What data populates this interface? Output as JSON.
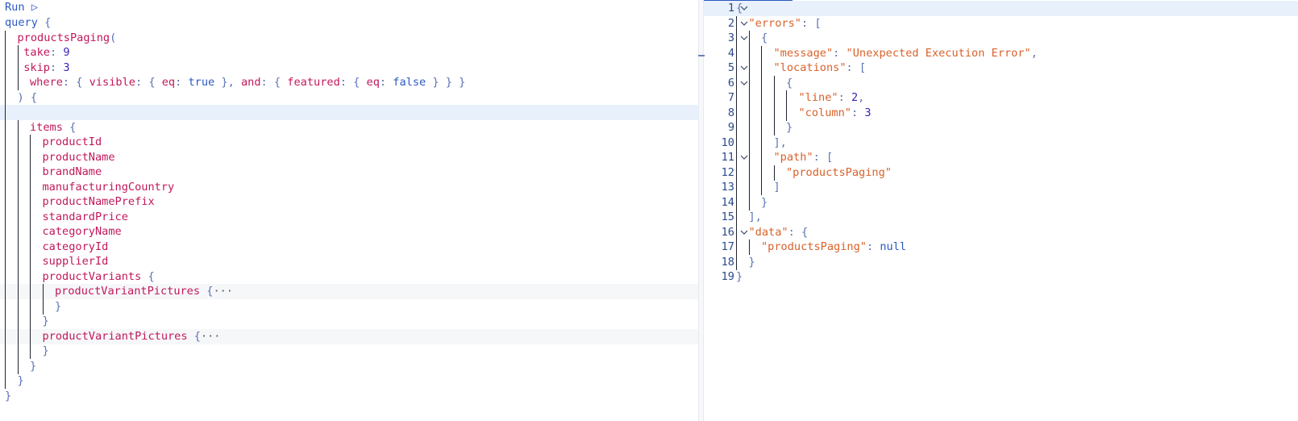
{
  "editor": {
    "run_label": "Run",
    "run_icon": "▷",
    "lines": [
      {
        "indent": 0,
        "tokens": [
          {
            "t": "query",
            "c": "kw"
          },
          {
            "t": " {",
            "c": "punct"
          }
        ]
      },
      {
        "indent": 1,
        "tokens": [
          {
            "t": "productsPaging",
            "c": "field"
          },
          {
            "t": "(",
            "c": "punct"
          }
        ]
      },
      {
        "indent": 1.5,
        "tokens": [
          {
            "t": "take",
            "c": "field"
          },
          {
            "t": ": ",
            "c": "punct"
          },
          {
            "t": "9",
            "c": "num"
          }
        ]
      },
      {
        "indent": 1.5,
        "tokens": [
          {
            "t": "skip",
            "c": "field"
          },
          {
            "t": ": ",
            "c": "punct"
          },
          {
            "t": "3",
            "c": "num"
          }
        ]
      },
      {
        "indent": 2,
        "tokens": [
          {
            "t": "where",
            "c": "field"
          },
          {
            "t": ": { ",
            "c": "punct"
          },
          {
            "t": "visible",
            "c": "field"
          },
          {
            "t": ": { ",
            "c": "punct"
          },
          {
            "t": "eq",
            "c": "field"
          },
          {
            "t": ": ",
            "c": "punct"
          },
          {
            "t": "true",
            "c": "bool"
          },
          {
            "t": " }, ",
            "c": "punct"
          },
          {
            "t": "and",
            "c": "field"
          },
          {
            "t": ": { ",
            "c": "punct"
          },
          {
            "t": "featured",
            "c": "field"
          },
          {
            "t": ": { ",
            "c": "punct"
          },
          {
            "t": "eq",
            "c": "field"
          },
          {
            "t": ": ",
            "c": "punct"
          },
          {
            "t": "false",
            "c": "bool"
          },
          {
            "t": " } } }",
            "c": "punct"
          }
        ]
      },
      {
        "indent": 1,
        "tokens": [
          {
            "t": ") {",
            "c": "punct"
          }
        ]
      },
      {
        "indent": 1,
        "tokens": [],
        "highlight": true
      },
      {
        "indent": 2,
        "tokens": [
          {
            "t": "items",
            "c": "field"
          },
          {
            "t": " {",
            "c": "punct"
          }
        ]
      },
      {
        "indent": 3,
        "tokens": [
          {
            "t": "productId",
            "c": "field"
          }
        ]
      },
      {
        "indent": 3,
        "tokens": [
          {
            "t": "productName",
            "c": "field"
          }
        ]
      },
      {
        "indent": 3,
        "tokens": [
          {
            "t": "brandName",
            "c": "field"
          }
        ]
      },
      {
        "indent": 3,
        "tokens": [
          {
            "t": "manufacturingCountry",
            "c": "field"
          }
        ]
      },
      {
        "indent": 3,
        "tokens": [
          {
            "t": "productNamePrefix",
            "c": "field"
          }
        ]
      },
      {
        "indent": 3,
        "tokens": [
          {
            "t": "standardPrice",
            "c": "field"
          }
        ]
      },
      {
        "indent": 3,
        "tokens": [
          {
            "t": "categoryName",
            "c": "field"
          }
        ]
      },
      {
        "indent": 3,
        "tokens": [
          {
            "t": "categoryId",
            "c": "field"
          }
        ]
      },
      {
        "indent": 3,
        "tokens": [
          {
            "t": "supplierId",
            "c": "field"
          }
        ]
      },
      {
        "indent": 3,
        "tokens": [
          {
            "t": "productVariants",
            "c": "field"
          },
          {
            "t": " {",
            "c": "punct"
          }
        ]
      },
      {
        "indent": 4,
        "tokens": [
          {
            "t": "productVariantPictures",
            "c": "field"
          },
          {
            "t": " {",
            "c": "punct"
          },
          {
            "t": "···",
            "c": "ell"
          }
        ],
        "fold": true
      },
      {
        "indent": 4,
        "tokens": [
          {
            "t": "}",
            "c": "punct"
          }
        ]
      },
      {
        "indent": 3,
        "tokens": [
          {
            "t": "}",
            "c": "punct"
          }
        ]
      },
      {
        "indent": 3,
        "tokens": [
          {
            "t": "productVariantPictures",
            "c": "field"
          },
          {
            "t": " {",
            "c": "punct"
          },
          {
            "t": "···",
            "c": "ell"
          }
        ],
        "fold": true
      },
      {
        "indent": 3,
        "tokens": [
          {
            "t": "}",
            "c": "punct"
          }
        ]
      },
      {
        "indent": 2,
        "tokens": [
          {
            "t": "}",
            "c": "punct"
          }
        ]
      },
      {
        "indent": 1,
        "tokens": [
          {
            "t": "}",
            "c": "punct"
          }
        ]
      },
      {
        "indent": 0,
        "tokens": [
          {
            "t": "}",
            "c": "punct"
          }
        ]
      }
    ]
  },
  "result": {
    "lines": [
      {
        "n": "1",
        "chev": true,
        "indent": 0,
        "tokens": [
          {
            "t": "{",
            "c": "jpunct"
          }
        ],
        "highlight": true
      },
      {
        "n": "2",
        "chev": true,
        "indent": 1,
        "tokens": [
          {
            "t": "\"errors\"",
            "c": "jkey"
          },
          {
            "t": ": [",
            "c": "jpunct"
          }
        ]
      },
      {
        "n": "3",
        "chev": true,
        "indent": 2,
        "tokens": [
          {
            "t": "{",
            "c": "jpunct"
          }
        ]
      },
      {
        "n": "4",
        "chev": false,
        "indent": 3,
        "tokens": [
          {
            "t": "\"message\"",
            "c": "jkey"
          },
          {
            "t": ": ",
            "c": "jpunct"
          },
          {
            "t": "\"Unexpected Execution Error\"",
            "c": "str"
          },
          {
            "t": ",",
            "c": "jpunct"
          }
        ]
      },
      {
        "n": "5",
        "chev": true,
        "indent": 3,
        "tokens": [
          {
            "t": "\"locations\"",
            "c": "jkey"
          },
          {
            "t": ": [",
            "c": "jpunct"
          }
        ]
      },
      {
        "n": "6",
        "chev": true,
        "indent": 4,
        "tokens": [
          {
            "t": "{",
            "c": "jpunct"
          }
        ]
      },
      {
        "n": "7",
        "chev": false,
        "indent": 5,
        "tokens": [
          {
            "t": "\"line\"",
            "c": "jkey"
          },
          {
            "t": ": ",
            "c": "jpunct"
          },
          {
            "t": "2",
            "c": "num"
          },
          {
            "t": ",",
            "c": "jpunct"
          }
        ]
      },
      {
        "n": "8",
        "chev": false,
        "indent": 5,
        "tokens": [
          {
            "t": "\"column\"",
            "c": "jkey"
          },
          {
            "t": ": ",
            "c": "jpunct"
          },
          {
            "t": "3",
            "c": "num"
          }
        ]
      },
      {
        "n": "9",
        "chev": false,
        "indent": 4,
        "tokens": [
          {
            "t": "}",
            "c": "jpunct"
          }
        ]
      },
      {
        "n": "10",
        "chev": false,
        "indent": 3,
        "tokens": [
          {
            "t": "],",
            "c": "jpunct"
          }
        ]
      },
      {
        "n": "11",
        "chev": true,
        "indent": 3,
        "tokens": [
          {
            "t": "\"path\"",
            "c": "jkey"
          },
          {
            "t": ": [",
            "c": "jpunct"
          }
        ]
      },
      {
        "n": "12",
        "chev": false,
        "indent": 4,
        "tokens": [
          {
            "t": "\"productsPaging\"",
            "c": "str"
          }
        ]
      },
      {
        "n": "13",
        "chev": false,
        "indent": 3,
        "tokens": [
          {
            "t": "]",
            "c": "jpunct"
          }
        ]
      },
      {
        "n": "14",
        "chev": false,
        "indent": 2,
        "tokens": [
          {
            "t": "}",
            "c": "jpunct"
          }
        ]
      },
      {
        "n": "15",
        "chev": false,
        "indent": 1,
        "tokens": [
          {
            "t": "],",
            "c": "jpunct"
          }
        ]
      },
      {
        "n": "16",
        "chev": true,
        "indent": 1,
        "tokens": [
          {
            "t": "\"data\"",
            "c": "jkey"
          },
          {
            "t": ": {",
            "c": "jpunct"
          }
        ]
      },
      {
        "n": "17",
        "chev": false,
        "indent": 2,
        "tokens": [
          {
            "t": "\"productsPaging\"",
            "c": "jkey"
          },
          {
            "t": ": ",
            "c": "jpunct"
          },
          {
            "t": "null",
            "c": "jnull"
          }
        ]
      },
      {
        "n": "18",
        "chev": false,
        "indent": 1,
        "tokens": [
          {
            "t": "}",
            "c": "jpunct"
          }
        ]
      },
      {
        "n": "19",
        "chev": false,
        "indent": 0,
        "tokens": [
          {
            "t": "}",
            "c": "jpunct"
          }
        ]
      }
    ]
  }
}
